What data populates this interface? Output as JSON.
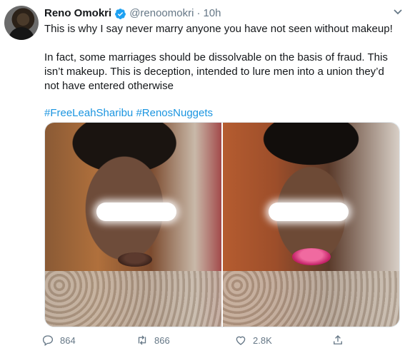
{
  "tweet": {
    "name": "Reno Omokri",
    "handle": "@renoomokri",
    "separator": "·",
    "time": "10h",
    "text_line1": "This is why I say never marry anyone you have not seen without makeup!",
    "text_para2": "In fact, some marriages should be dissolvable on the basis of fraud. This isn’t makeup. This is deception, intended to lure men into a union they’d not have entered otherwise",
    "hashtags": [
      "#FreeLeahSharibu",
      "#RenosNuggets"
    ]
  },
  "actions": {
    "replies": "864",
    "retweets": "866",
    "likes": "2.8K"
  },
  "icons": {
    "verified": "verified-badge-icon",
    "caret": "chevron-down-icon",
    "reply": "reply-icon",
    "retweet": "retweet-icon",
    "like": "heart-icon",
    "share": "share-icon"
  },
  "colors": {
    "accent": "#1b95e0",
    "text": "#14171a",
    "muted": "#657786"
  }
}
